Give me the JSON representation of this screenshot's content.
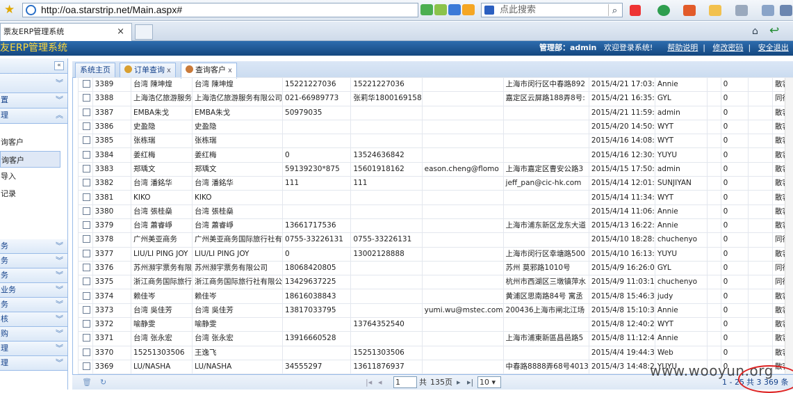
{
  "browser": {
    "url": "http://oa.starstrip.net/Main.aspx#",
    "search_placeholder": "点此搜索",
    "tab_title": "票友ERP管理系统"
  },
  "app": {
    "title": "友ERP管理系统",
    "dept_label": "管理部：admin",
    "welcome": "欢迎登录系统!",
    "help": "帮助说明",
    "change_pwd": "修改密码",
    "logout": "安全退出",
    "sep": "|"
  },
  "sidebar": {
    "collapse": "«",
    "groups_top": [
      "",
      "置",
      "理"
    ],
    "subitems": [
      "询客户",
      "询客户",
      "导入",
      "记录"
    ],
    "groups_bottom": [
      "务",
      "务",
      "务",
      "业务",
      "务",
      "核",
      "购",
      "理",
      "理"
    ]
  },
  "tabs": [
    {
      "label": "系统主页"
    },
    {
      "label": "订单查询",
      "close": "x"
    },
    {
      "label": "查询客户",
      "close": "x"
    }
  ],
  "rows": [
    [
      "3389",
      "台湾  陳坤煌",
      "台湾  陳坤煌",
      "15221227036",
      "15221227036",
      "",
      "上海市闵行区中春路892",
      "2015/4/21 17:03:",
      "Annie",
      "",
      "0",
      "",
      "散客"
    ],
    [
      "3388",
      "上海浩亿旅游服务",
      "上海浩亿旅游服务有限公司",
      "021-66989773",
      "张莉华1800169158",
      "",
      "嘉定区云屏路188弄8号:",
      "2015/4/21 16:35:",
      "GYL",
      "",
      "0",
      "",
      "同行"
    ],
    [
      "3387",
      "EMBA朱戈",
      "EMBA朱戈",
      "50979035",
      "",
      "",
      "",
      "2015/4/21 11:59:",
      "admin",
      "",
      "0",
      "",
      "散客"
    ],
    [
      "3386",
      "史盈隐",
      "史盈隐",
      "",
      "",
      "",
      "",
      "2015/4/20 14:50:",
      "WYT",
      "",
      "0",
      "",
      "散客"
    ],
    [
      "3385",
      "张栋瑞",
      "张栋瑞",
      "",
      "",
      "",
      "",
      "2015/4/16 14:08:",
      "WYT",
      "",
      "0",
      "",
      "散客"
    ],
    [
      "3384",
      "姜红梅",
      "姜红梅",
      "0",
      "13524636842",
      "",
      "",
      "2015/4/16 12:30:",
      "YUYU",
      "",
      "0",
      "",
      "散客"
    ],
    [
      "3383",
      "郑瑀文",
      "郑瑀文",
      "59139230*875",
      "15601918162",
      "eason.cheng@flomo",
      "上海市嘉定区曹安公路3",
      "2015/4/15 17:50:",
      "admin",
      "",
      "0",
      "",
      "散客"
    ],
    [
      "3382",
      "台湾  潘銘华",
      "台湾  潘銘华",
      "111",
      "111",
      "",
      "jeff_pan@cic-hk.com",
      "2015/4/14 12:01:",
      "SUNJIYAN",
      "",
      "0",
      "",
      "散客"
    ],
    [
      "3381",
      "KIKO",
      "KIKO",
      "",
      "",
      "",
      "",
      "2015/4/14 11:34:",
      "WYT",
      "",
      "0",
      "",
      "散客"
    ],
    [
      "3380",
      "台湾  張桂燊",
      "台湾  張桂燊",
      "",
      "",
      "",
      "",
      "2015/4/14 11:06:",
      "Annie",
      "",
      "0",
      "",
      "散客"
    ],
    [
      "3379",
      "台湾  蕭睿崢",
      "台湾  蕭睿崢",
      "13661717536",
      "",
      "",
      "上海市浦东新区龙东大道",
      "2015/4/13 16:22:",
      "Annie",
      "",
      "0",
      "",
      "散客"
    ],
    [
      "3378",
      "广州美亚商务",
      "广州美亚商务国际旅行社有",
      "0755-33226131",
      "0755-33226131",
      "",
      "",
      "2015/4/10 18:28:",
      "chuchenyo",
      "",
      "0",
      "",
      "同行"
    ],
    [
      "3377",
      "LIU/LI PING JOY",
      "LIU/LI PING JOY",
      "0",
      "13002128888",
      "",
      "上海市闵行区幸塘路500",
      "2015/4/10 16:13:",
      "YUYU",
      "",
      "0",
      "",
      "散客"
    ],
    [
      "3376",
      "苏州瀕宇票务有限",
      "苏州瀕宇票务有限公司",
      "18068420805",
      "",
      "",
      "苏州  莫邪路1010号",
      "2015/4/9 16:26:0",
      "GYL",
      "",
      "0",
      "",
      "同行"
    ],
    [
      "3375",
      "浙江商务国际旅行",
      "浙江商务国际旅行社有限公",
      "13429637225",
      "",
      "",
      "杭州市西湖区三墩镇萍水",
      "2015/4/9 11:03:1",
      "chuchenyo",
      "",
      "0",
      "",
      "同行"
    ],
    [
      "3374",
      "赖佳岑",
      "赖佳岑",
      "18616038843",
      "",
      "",
      "黄浦区思南路84号  寓丞",
      "2015/4/8 15:46:3",
      "judy",
      "",
      "0",
      "",
      "散客"
    ],
    [
      "3373",
      "台湾  吳佳芳",
      "台湾  吳佳芳",
      "13817033795",
      "",
      "yumi.wu@mstec.com",
      "200436上海市闸北江场",
      "2015/4/8 15:10:3",
      "Annie",
      "",
      "0",
      "",
      "散客"
    ],
    [
      "3372",
      "喻静雯",
      "喻静雯",
      "",
      "13764352540",
      "",
      "",
      "2015/4/8 12:40:2",
      "WYT",
      "",
      "0",
      "",
      "散客"
    ],
    [
      "3371",
      "台湾  张永宏",
      "台湾  张永宏",
      "13916660528",
      "",
      "",
      "上海市浦東新區昌邑路5",
      "2015/4/8 11:12:4",
      "Annie",
      "",
      "0",
      "",
      "散客"
    ],
    [
      "3370",
      "15251303506",
      "王逸飞",
      "",
      "15251303506",
      "",
      "",
      "2015/4/4 19:44:3",
      "Web",
      "",
      "0",
      "",
      "散客"
    ],
    [
      "3369",
      "LU/NASHA",
      "LU/NASHA",
      "34555297",
      "13611876937",
      "",
      "中春路8888弄68号4013",
      "2015/4/3 14:48:2",
      "YUYU",
      "",
      "0",
      "",
      "散客"
    ]
  ],
  "pager": {
    "page": "1",
    "of": "共",
    "pages": "135页",
    "page_size": "10",
    "range": "1 - 25",
    "total": "共 3 369 条"
  },
  "watermark": "www.wooyun.org"
}
